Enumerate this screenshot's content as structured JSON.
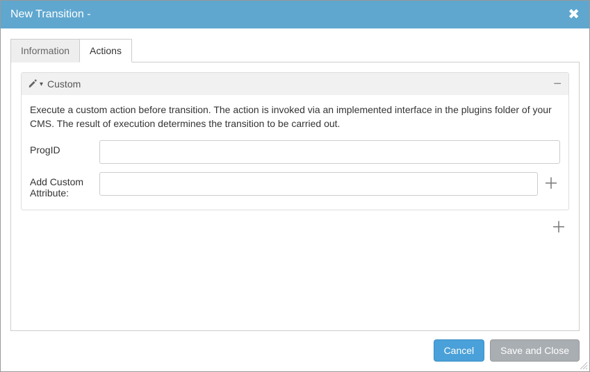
{
  "dialog": {
    "title": "New Transition -"
  },
  "tabs": [
    {
      "id": "information",
      "label": "Information",
      "active": false
    },
    {
      "id": "actions",
      "label": "Actions",
      "active": true
    }
  ],
  "panel": {
    "title": "Custom",
    "description": "Execute a custom action before transition. The action is invoked via an implemented interface in the plugins folder of your CMS. The result of execution determines the transition to be carried out.",
    "fields": {
      "progId": {
        "label": "ProgID",
        "value": ""
      },
      "addCustomAttribute": {
        "label": "Add Custom Attribute:",
        "value": ""
      }
    }
  },
  "buttons": {
    "cancel": "Cancel",
    "saveAndClose": "Save and Close"
  },
  "icons": {
    "close": "✖",
    "plus": "＋",
    "minus": "−",
    "caretDown": "▾"
  }
}
